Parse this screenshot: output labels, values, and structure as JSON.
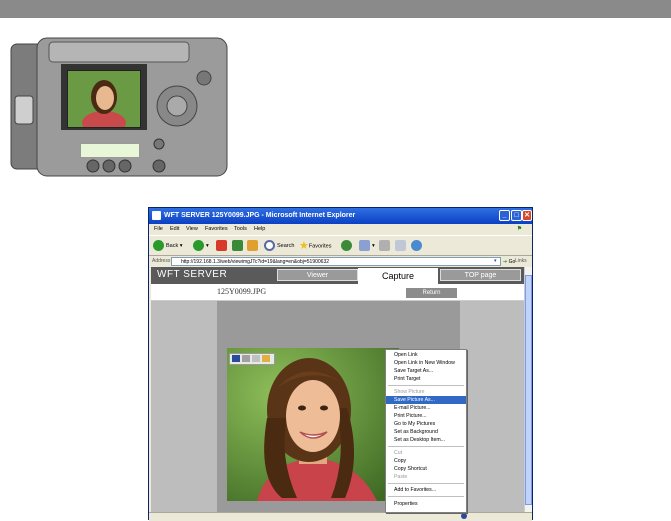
{
  "window": {
    "title": "WFT SERVER 125Y0099.JPG - Microsoft Internet Explorer",
    "controls": {
      "minimize": "_",
      "maximize": "□",
      "close": "✕"
    }
  },
  "menubar": [
    "File",
    "Edit",
    "View",
    "Favorites",
    "Tools",
    "Help"
  ],
  "toolbar": {
    "back": "Back",
    "search": "Search",
    "favorites": "Favorites"
  },
  "address": {
    "label": "Address",
    "url": "http://192.168.1.3/web/viewimgJTc?id=19&lang=en&obj=51900632",
    "go": "Go",
    "links": "Links"
  },
  "page": {
    "brand": "WFT SERVER",
    "tabs": [
      "Viewer",
      "Capture",
      "TOP page"
    ],
    "filename": "125Y0099.JPG",
    "return_label": "Return"
  },
  "context_menu": {
    "items": [
      {
        "label": "Open Link",
        "disabled": false
      },
      {
        "label": "Open Link in New Window",
        "disabled": false
      },
      {
        "label": "Save Target As...",
        "disabled": false
      },
      {
        "label": "Print Target",
        "disabled": false
      },
      {
        "label": "Show Picture",
        "disabled": true
      },
      {
        "label": "Save Picture As...",
        "disabled": false,
        "selected": true
      },
      {
        "label": "E-mail Picture...",
        "disabled": false
      },
      {
        "label": "Print Picture...",
        "disabled": false
      },
      {
        "label": "Go to My Pictures",
        "disabled": false
      },
      {
        "label": "Set as Background",
        "disabled": false
      },
      {
        "label": "Set as Desktop Item...",
        "disabled": false
      },
      {
        "label": "Cut",
        "disabled": true
      },
      {
        "label": "Copy",
        "disabled": false
      },
      {
        "label": "Copy Shortcut",
        "disabled": false
      },
      {
        "label": "Paste",
        "disabled": true
      },
      {
        "label": "Add to Favorites...",
        "disabled": false
      },
      {
        "label": "Properties",
        "disabled": false
      }
    ]
  },
  "colors": {
    "titlebar": "#0b3fc4",
    "selection": "#316ac5",
    "navbar": "#5a5a5a"
  }
}
